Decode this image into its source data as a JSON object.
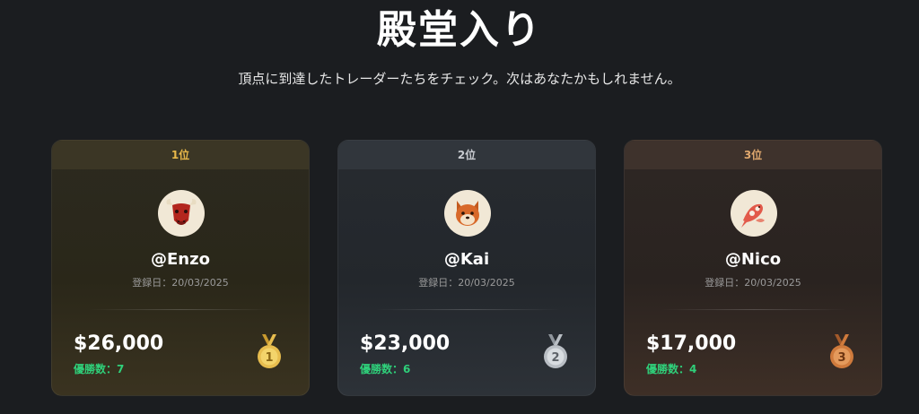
{
  "header": {
    "title": "殿堂入り",
    "subtitle": "頂点に到達したトレーダーたちをチェック。次はあなたかもしれません。"
  },
  "cards": [
    {
      "rank_label": "1位",
      "avatar_icon": "bull-icon",
      "username": "@Enzo",
      "registered": "登録日：20/03/2025",
      "amount": "$26,000",
      "wins": "優勝数：7",
      "medal_icon": "gold-medal-icon",
      "medal_number": "1",
      "accent": "#e8b84a"
    },
    {
      "rank_label": "2位",
      "avatar_icon": "shiba-dog-icon",
      "username": "@Kai",
      "registered": "登録日：20/03/2025",
      "amount": "$23,000",
      "wins": "優勝数：6",
      "medal_icon": "silver-medal-icon",
      "medal_number": "2",
      "accent": "#c9ccd1"
    },
    {
      "rank_label": "3位",
      "avatar_icon": "koi-fish-icon",
      "username": "@Nico",
      "registered": "登録日：20/03/2025",
      "amount": "$17,000",
      "wins": "優勝数：4",
      "medal_icon": "bronze-medal-icon",
      "medal_number": "3",
      "accent": "#e0a86e"
    }
  ],
  "colors": {
    "background": "#1b1d20",
    "wins_green": "#2fd07a"
  }
}
